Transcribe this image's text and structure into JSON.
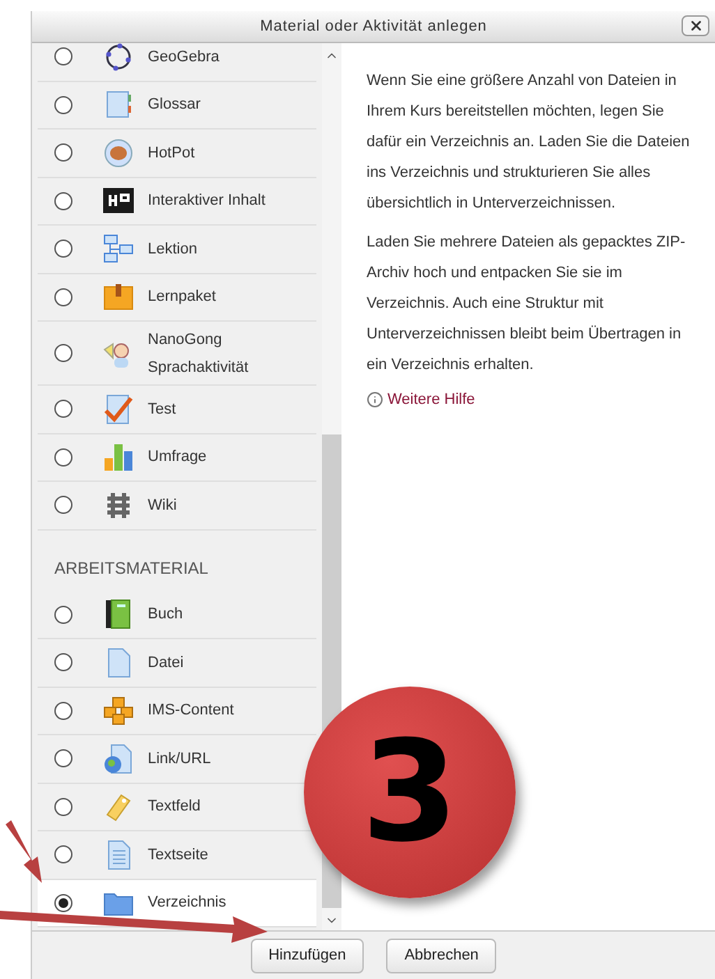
{
  "dialog": {
    "title": "Material oder Aktivität anlegen"
  },
  "activities": [
    {
      "label": "GeoGebra",
      "selected": false
    },
    {
      "label": "Glossar",
      "selected": false
    },
    {
      "label": "HotPot",
      "selected": false
    },
    {
      "label": "Interaktiver Inhalt",
      "selected": false
    },
    {
      "label": "Lektion",
      "selected": false
    },
    {
      "label": "Lernpaket",
      "selected": false
    },
    {
      "label": "NanoGong Sprachaktivität",
      "selected": false
    },
    {
      "label": "Test",
      "selected": false
    },
    {
      "label": "Umfrage",
      "selected": false
    },
    {
      "label": "Wiki",
      "selected": false
    }
  ],
  "resources": {
    "heading": "ARBEITSMATERIAL",
    "items": [
      {
        "label": "Buch",
        "selected": false
      },
      {
        "label": "Datei",
        "selected": false
      },
      {
        "label": "IMS-Content",
        "selected": false
      },
      {
        "label": "Link/URL",
        "selected": false
      },
      {
        "label": "Textfeld",
        "selected": false
      },
      {
        "label": "Textseite",
        "selected": false
      },
      {
        "label": "Verzeichnis",
        "selected": true
      }
    ]
  },
  "description": {
    "paragraphs": [
      "Wenn Sie eine größere Anzahl von Dateien in Ihrem Kurs bereitstellen möchten, legen Sie dafür ein Verzeichnis an. Laden Sie die Dateien ins Verzeichnis und strukturieren Sie alles übersichtlich in Unterverzeichnissen.",
      "Laden Sie mehrere Dateien als gepacktes ZIP-Archiv hoch und entpacken Sie sie im Verzeichnis. Auch eine Struktur mit Unterverzeichnissen bleibt beim Übertragen in ein Verzeichnis erhalten."
    ],
    "help_link": "Weitere Hilfe"
  },
  "buttons": [
    "Hinzufügen",
    "Abbrechen"
  ],
  "annotation": {
    "badge": "3"
  }
}
